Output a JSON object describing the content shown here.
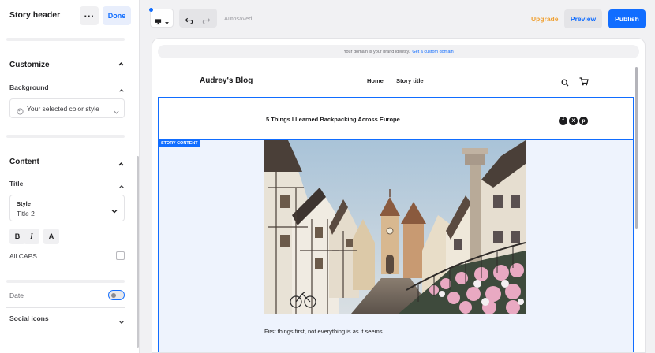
{
  "sidebar": {
    "title": "Story header",
    "more_glyph": "···",
    "done_label": "Done",
    "customize": {
      "title": "Customize",
      "background_label": "Background",
      "background_value": "Your selected color style"
    },
    "content": {
      "title": "Content",
      "title_section_label": "Title",
      "style_label": "Style",
      "style_value": "Title 2",
      "bold_label": "B",
      "italic_label": "I",
      "color_label": "A",
      "all_caps_label": "All CAPS",
      "all_caps_checked": false,
      "date_label": "Date",
      "date_enabled": false,
      "social_icons_label": "Social icons"
    }
  },
  "toolbar": {
    "autosave_status": "Autosaved",
    "upgrade_label": "Upgrade",
    "preview_label": "Preview",
    "publish_label": "Publish",
    "accent_color": "#116dff",
    "upgrade_color": "#f0a031"
  },
  "site": {
    "domain_banner_text": "Your domain is your brand identity.",
    "domain_banner_link": "Get a custom domain",
    "blog_name": "Audrey's Blog",
    "nav": [
      "Home",
      "Story title"
    ],
    "story_title": "5 Things I Learned Backpacking Across Europe",
    "story_content_badge": "STORY CONTENT",
    "body_text": "First things first, not everything is as it seems."
  }
}
